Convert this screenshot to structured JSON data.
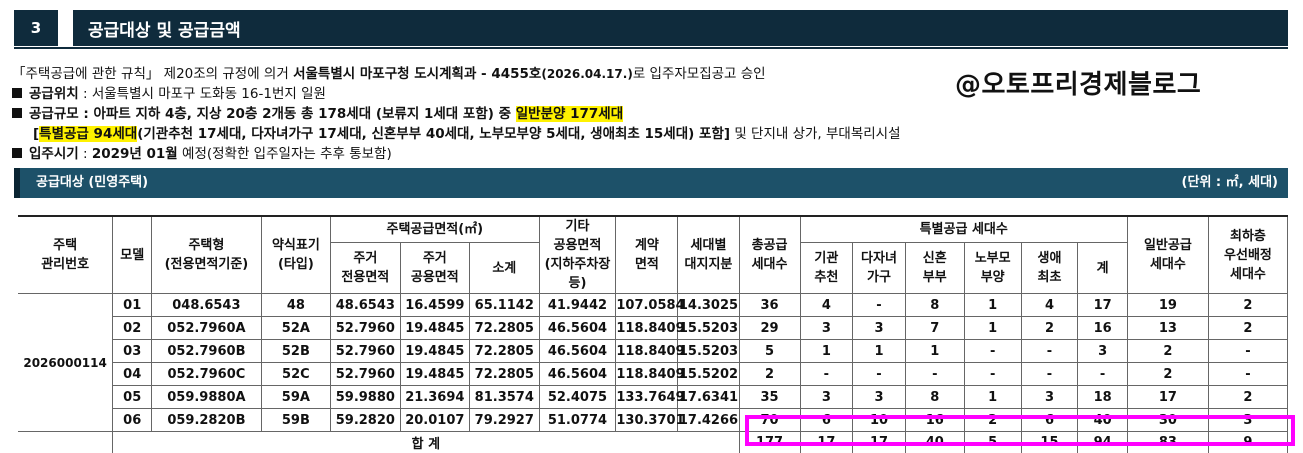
{
  "header": {
    "number": "3",
    "title": "공급대상 및 공급금액"
  },
  "info": {
    "line1_a": "「주택공급에 관한 규칙」 제20조의 규정에 의거 ",
    "line1_b": "서울특별시 마포구청 도시계획과 - 4455호",
    "line1_c": "(2026.04.17.)",
    "line1_d": "로 입주자모집공고 승인",
    "loc_label": "공급위치",
    "loc_value": " : 서울특별시 마포구 도화동 16-1번지 일원",
    "scale_label": "공급규모",
    "scale_value": " : 아파트 지하 4층, 지상 20층 2개동 총 178세대 (보류지 1세대 포함) 중 ",
    "scale_general": "일반분양 177세대",
    "scale2_bracket": "[",
    "scale2_special": "특별공급 94세대",
    "scale2_detail": "(기관추천 17세대, 다자녀가구 17세대, 신혼부부 40세대, 노부모부양 5세대, 생애최초 15세대) 포함]",
    "scale2_tail": " 및 단지내 상가, 부대복리시설",
    "movein_label": "입주시기",
    "movein_sep": " : ",
    "movein_value": "2029년 01월",
    "movein_tail": " 예정(정확한 입주일자는 추후 통보함)"
  },
  "watermark": "@오토프리경제블로그",
  "subheader": {
    "title": "공급대상 (민영주택)",
    "unit": "(단위 : ㎡, 세대)"
  },
  "table": {
    "h_mgmt": "주택\n관리번호",
    "h_model": "모델",
    "h_type": "주택형\n(전용면적기준)",
    "h_abbr": "약식표기\n(타입)",
    "h_area": "주택공급면적(㎡)",
    "h_excl": "주거\n전용면적",
    "h_common": "주거\n공용면적",
    "h_subtotal": "소계",
    "h_other": "기타\n공용면적\n(지하주차장등)",
    "h_contract": "계약\n면적",
    "h_land": "세대별\n대지지분",
    "h_total": "총공급\n세대수",
    "h_special": "특별공급 세대수",
    "h_inst": "기관\n추천",
    "h_multi": "다자녀\n가구",
    "h_newly": "신혼\n부부",
    "h_elder": "노부모\n부양",
    "h_first": "생애\n최초",
    "h_sum": "계",
    "h_general": "일반공급\n세대수",
    "h_lowest": "최하층\n우선배정\n세대수",
    "mgmt_no": "2026000114",
    "rows": [
      [
        "01",
        "048.6543",
        "48",
        "48.6543",
        "16.4599",
        "65.1142",
        "41.9442",
        "107.0584",
        "14.3025",
        "36",
        "4",
        "-",
        "8",
        "1",
        "4",
        "17",
        "19",
        "2"
      ],
      [
        "02",
        "052.7960A",
        "52A",
        "52.7960",
        "19.4845",
        "72.2805",
        "46.5604",
        "118.8409",
        "15.5203",
        "29",
        "3",
        "3",
        "7",
        "1",
        "2",
        "16",
        "13",
        "2"
      ],
      [
        "03",
        "052.7960B",
        "52B",
        "52.7960",
        "19.4845",
        "72.2805",
        "46.5604",
        "118.8409",
        "15.5203",
        "5",
        "1",
        "1",
        "1",
        "-",
        "-",
        "3",
        "2",
        "-"
      ],
      [
        "04",
        "052.7960C",
        "52C",
        "52.7960",
        "19.4845",
        "72.2805",
        "46.5604",
        "118.8409",
        "15.5202",
        "2",
        "-",
        "-",
        "-",
        "-",
        "-",
        "-",
        "2",
        "-"
      ],
      [
        "05",
        "059.9880A",
        "59A",
        "59.9880",
        "21.3694",
        "81.3574",
        "52.4075",
        "133.7649",
        "17.6341",
        "35",
        "3",
        "3",
        "8",
        "1",
        "3",
        "18",
        "17",
        "2"
      ],
      [
        "06",
        "059.2820B",
        "59B",
        "59.2820",
        "20.0107",
        "79.2927",
        "51.0774",
        "130.3701",
        "17.4266",
        "70",
        "6",
        "10",
        "16",
        "2",
        "6",
        "40",
        "30",
        "3"
      ]
    ],
    "total_label": "합 계",
    "totals": [
      "177",
      "17",
      "17",
      "40",
      "5",
      "15",
      "94",
      "83",
      "9"
    ]
  },
  "colors": {
    "header_bg": "#0f2b3c",
    "subbar_bg": "#1d5169",
    "highlight": "#fff200",
    "emphasis_box": "#ff00ff"
  }
}
